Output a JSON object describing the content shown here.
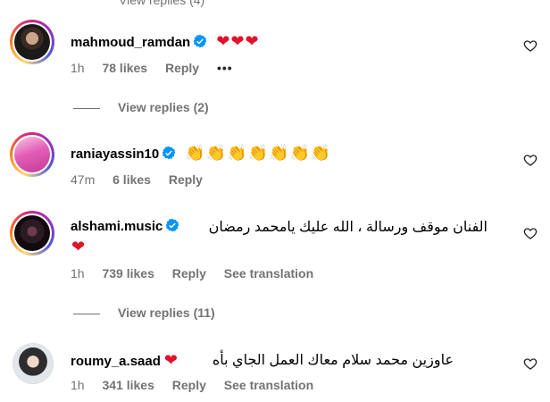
{
  "top_partial_link": "View replies (4)",
  "comments": [
    {
      "username": "mahmoud_ramdan",
      "verified": true,
      "text": "❤❤❤",
      "time": "1h",
      "likes": "78 likes",
      "reply": "Reply",
      "more": "•••",
      "view_replies": "View replies (2)"
    },
    {
      "username": "raniayassin10",
      "verified": true,
      "text": "👏👏👏👏👏👏👏",
      "time": "47m",
      "likes": "6 likes",
      "reply": "Reply"
    },
    {
      "username": "alshami.music",
      "verified": true,
      "text": "الفنان موقف ورسالة ، الله عليك يامحمد رمضان",
      "text2": "❤",
      "time": "1h",
      "likes": "739 likes",
      "reply": "Reply",
      "translate": "See translation",
      "view_replies": "View replies (11)"
    },
    {
      "username": "roumy_a.saad",
      "verified": false,
      "text": "عاوزين محمد سلام معاك العمل الجاي بأه",
      "text_emoji": "❤",
      "time": "1h",
      "likes": "341 likes",
      "reply": "Reply",
      "translate": "See translation"
    }
  ],
  "colors": {
    "secondary_text": "#737373",
    "verified_blue": "#0095f6",
    "heart": "#e0122b"
  }
}
